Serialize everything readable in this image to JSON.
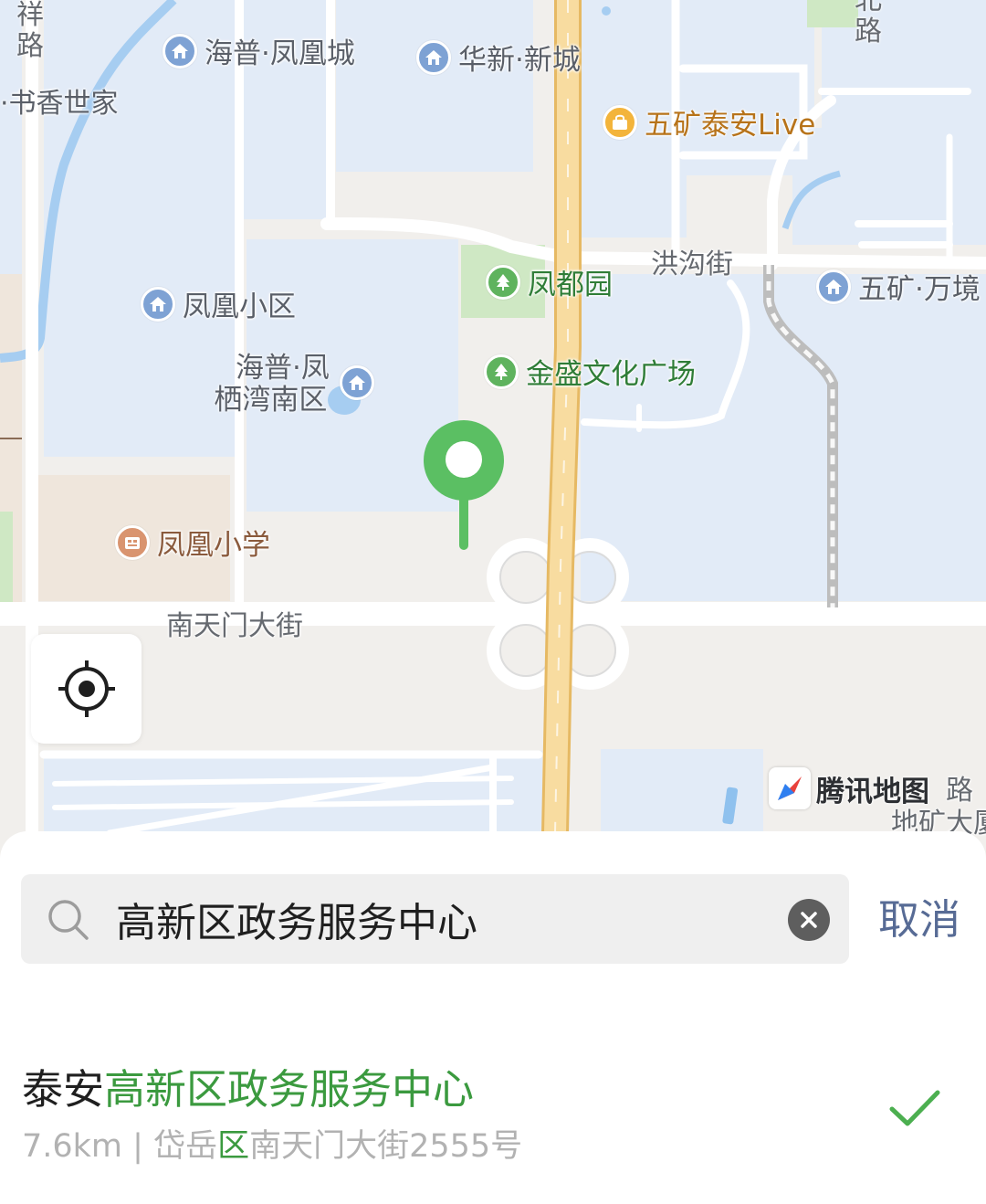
{
  "map": {
    "pois": [
      {
        "name": "海普·凤凰城",
        "kind": "residential-icon"
      },
      {
        "name": "华新·新城",
        "kind": "residential-icon"
      },
      {
        "name": "五矿泰安Live",
        "kind": "shopping-icon"
      },
      {
        "name": "凤都园",
        "kind": "park-icon"
      },
      {
        "name": "五矿·万境",
        "kind": "residential-icon"
      },
      {
        "name": "凤凰小区",
        "kind": "residential-icon"
      },
      {
        "name": "金盛文化广场",
        "kind": "park-icon"
      },
      {
        "name": "海普·凤",
        "name_line2": "栖湾南区",
        "kind": "residential-icon"
      },
      {
        "name": "凤凰小学",
        "kind": "school-icon"
      }
    ],
    "partial_labels": {
      "book_home": "书香世家",
      "top_left_road": "祥路",
      "top_right_road": "北路",
      "bottom_right_1": "路",
      "bottom_right_2": "地矿大厦"
    },
    "roads": {
      "honggou": "洪沟街",
      "nantianmen": "南天门大街"
    },
    "brand": "腾讯地图",
    "colors": {
      "marker": "#5bbf63",
      "block": "#e2ebf7",
      "main_road": "#f6d47e",
      "park": "#cfe8c4"
    }
  },
  "search": {
    "value": "高新区政务服务中心",
    "cancel_label": "取消"
  },
  "result": {
    "title_prefix": "泰安",
    "title_match": "高新区政务服务中心",
    "sub_prefix": "7.6km | 岱岳",
    "sub_match": "区",
    "sub_suffix": "南天门大街2555号"
  }
}
